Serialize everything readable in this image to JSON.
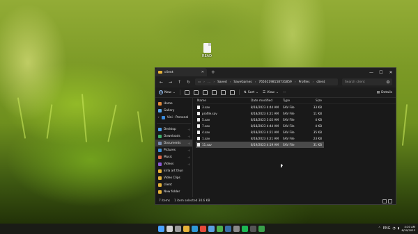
{
  "desktop": {
    "icon_label": "READ"
  },
  "window": {
    "tab_title": "client",
    "new_tab": "+",
    "controls": {
      "minimize": "—",
      "maximize": "☐",
      "close": "✕"
    }
  },
  "address": {
    "crumbs": [
      "Saved",
      "SaveGames",
      "76561198158731859",
      "Profiles",
      "client"
    ],
    "search_placeholder": "Search client"
  },
  "commandbar": {
    "new_label": "New",
    "sort_label": "Sort",
    "view_label": "View",
    "more_label": "···",
    "details_label": "Details"
  },
  "sidebar": {
    "items": [
      {
        "label": "Home",
        "icon_color": "#e08a3c",
        "pinned": false
      },
      {
        "label": "Gallery",
        "icon_color": "#58a6e8",
        "pinned": false
      },
      {
        "label": "Vini - Personal",
        "icon_color": "#3b8de0",
        "pinned": false
      },
      {
        "label": "Desktop",
        "icon_color": "#4c9de6",
        "pinned": true
      },
      {
        "label": "Downloads",
        "icon_color": "#3dae6a",
        "pinned": true
      },
      {
        "label": "Documents",
        "icon_color": "#7a8fb0",
        "pinned": true
      },
      {
        "label": "Pictures",
        "icon_color": "#3f8fd6",
        "pinned": true
      },
      {
        "label": "Music",
        "icon_color": "#e06b4a",
        "pinned": true
      },
      {
        "label": "Videos",
        "icon_color": "#8c5ad6",
        "pinned": true
      },
      {
        "label": "kirla art thun",
        "icon_color": "#e6b33a",
        "pinned": false
      },
      {
        "label": "Video Clips",
        "icon_color": "#e6b33a",
        "pinned": false
      },
      {
        "label": "client",
        "icon_color": "#e6b33a",
        "pinned": false
      },
      {
        "label": "New folder",
        "icon_color": "#e6b33a",
        "pinned": false
      }
    ]
  },
  "files": {
    "headers": {
      "name": "Name",
      "date": "Date modified",
      "type": "Type",
      "size": "Size"
    },
    "rows": [
      {
        "name": "3.sav",
        "date": "8/18/2023 4:44 AM",
        "type": "SAV File",
        "size": "33 KB"
      },
      {
        "name": "profile.sav",
        "date": "8/18/2023 4:21 AM",
        "type": "SAV File",
        "size": "11 KB"
      },
      {
        "name": "5.sav",
        "date": "8/18/2023 3:02 AM",
        "type": "SAV File",
        "size": "4 KB"
      },
      {
        "name": "7.sav",
        "date": "8/18/2023 4:44 AM",
        "type": "SAV File",
        "size": "4 KB"
      },
      {
        "name": "4.sav",
        "date": "8/18/2023 4:21 AM",
        "type": "SAV File",
        "size": "35 KB"
      },
      {
        "name": "1.sav",
        "date": "8/18/2023 4:21 AM",
        "type": "SAV File",
        "size": "23 KB"
      },
      {
        "name": "11.sav",
        "date": "8/19/2023 4:19 AM",
        "type": "SAV File",
        "size": "31 KB"
      }
    ]
  },
  "status": {
    "items_count": "7 items",
    "selection": "1 item selected  30.6 KB"
  },
  "taskbar": {
    "icons": [
      {
        "name": "start",
        "color": "#4aa3ff"
      },
      {
        "name": "search",
        "color": "#d0d0d0"
      },
      {
        "name": "task-view",
        "color": "#9a9a9a"
      },
      {
        "name": "explorer",
        "color": "#e6b33a"
      },
      {
        "name": "edge",
        "color": "#2f9ad8"
      },
      {
        "name": "chrome",
        "color": "#e64a3a"
      },
      {
        "name": "store",
        "color": "#5aa0e0"
      },
      {
        "name": "xbox",
        "color": "#4cb04c"
      },
      {
        "name": "steam",
        "color": "#3a6ea5"
      },
      {
        "name": "settings",
        "color": "#8a8a8a"
      },
      {
        "name": "spotify",
        "color": "#1db954"
      },
      {
        "name": "terminal",
        "color": "#555555"
      },
      {
        "name": "app",
        "color": "#3aa04a"
      }
    ],
    "lang": "ENG",
    "time": "4:20 AM",
    "date": "8/20/2023"
  }
}
